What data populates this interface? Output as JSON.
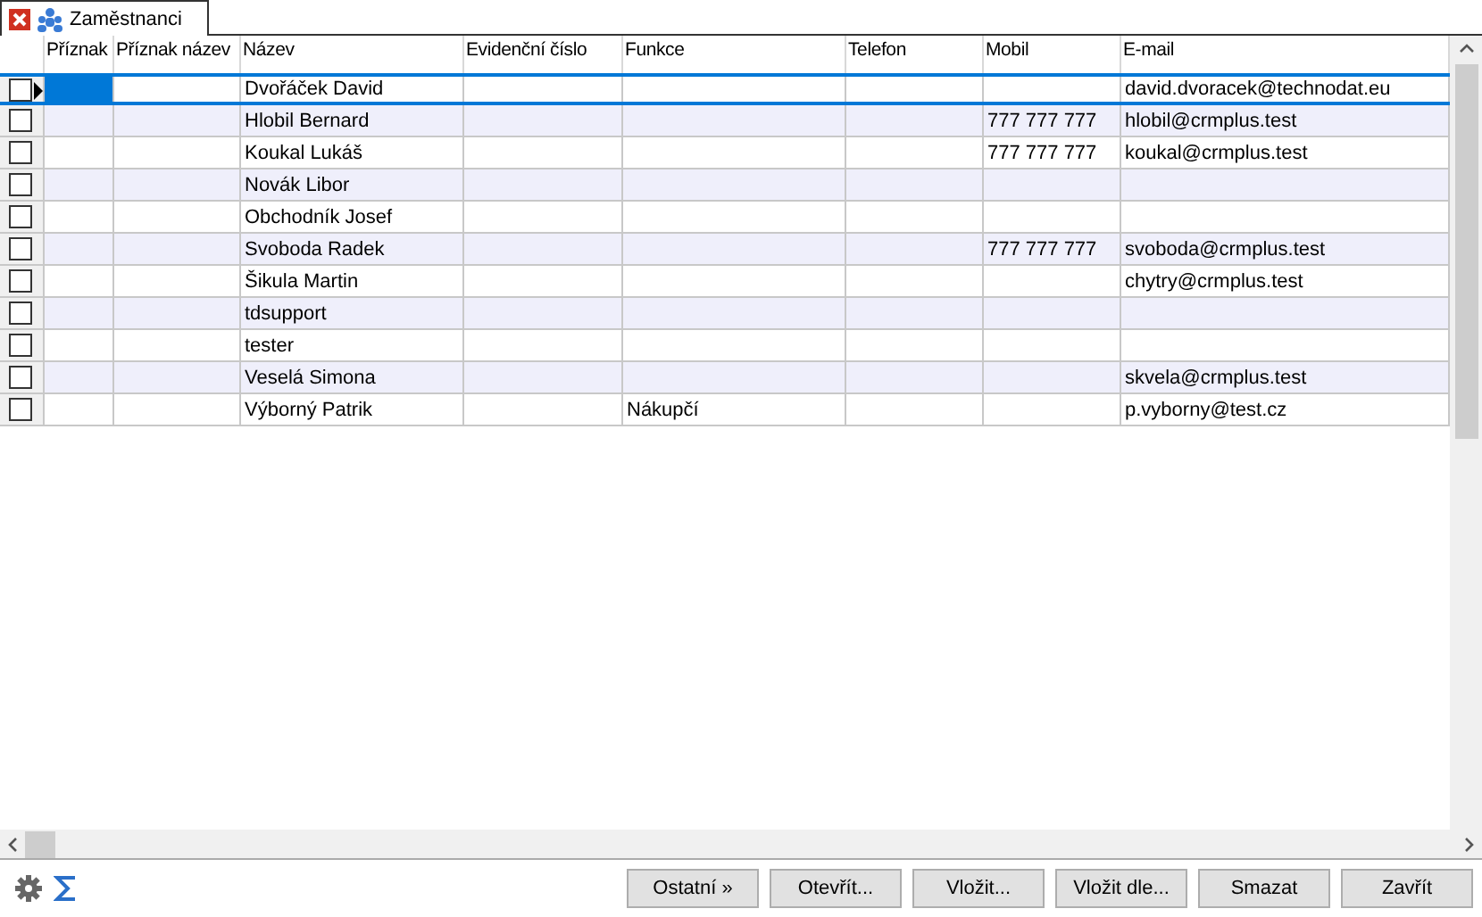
{
  "tab": {
    "title": "Zaměstnanci",
    "selected": true
  },
  "table": {
    "columns": [
      "Příznak",
      "Příznak název",
      "Název",
      "Evidenční číslo",
      "Funkce",
      "Telefon",
      "Mobil",
      "E-mail"
    ],
    "rows": [
      {
        "selected": true,
        "checked": false,
        "cells": [
          "",
          "",
          "Dvořáček David",
          "",
          "",
          "",
          "",
          "david.dvoracek@technodat.eu"
        ]
      },
      {
        "selected": false,
        "checked": false,
        "cells": [
          "",
          "",
          "Hlobil Bernard",
          "",
          "",
          "",
          "777 777 777",
          "hlobil@crmplus.test"
        ]
      },
      {
        "selected": false,
        "checked": false,
        "cells": [
          "",
          "",
          "Koukal Lukáš",
          "",
          "",
          "",
          "777 777 777",
          "koukal@crmplus.test"
        ]
      },
      {
        "selected": false,
        "checked": false,
        "cells": [
          "",
          "",
          "Novák Libor",
          "",
          "",
          "",
          "",
          ""
        ]
      },
      {
        "selected": false,
        "checked": false,
        "cells": [
          "",
          "",
          "Obchodník Josef",
          "",
          "",
          "",
          "",
          ""
        ]
      },
      {
        "selected": false,
        "checked": false,
        "cells": [
          "",
          "",
          "Svoboda Radek",
          "",
          "",
          "",
          "777 777 777",
          "svoboda@crmplus.test"
        ]
      },
      {
        "selected": false,
        "checked": false,
        "cells": [
          "",
          "",
          "Šikula Martin",
          "",
          "",
          "",
          "",
          "chytry@crmplus.test"
        ]
      },
      {
        "selected": false,
        "checked": false,
        "cells": [
          "",
          "",
          "tdsupport",
          "",
          "",
          "",
          "",
          ""
        ]
      },
      {
        "selected": false,
        "checked": false,
        "cells": [
          "",
          "",
          "tester",
          "",
          "",
          "",
          "",
          ""
        ]
      },
      {
        "selected": false,
        "checked": false,
        "cells": [
          "",
          "",
          "Veselá Simona",
          "",
          "",
          "",
          "",
          "skvela@crmplus.test"
        ]
      },
      {
        "selected": false,
        "checked": false,
        "cells": [
          "",
          "",
          "Výborný Patrik",
          "",
          "Nákupčí",
          "",
          "",
          "p.vyborny@test.cz"
        ]
      }
    ]
  },
  "buttons": [
    "Ostatní »",
    "Otevřít...",
    "Vložit...",
    "Vložit dle...",
    "Smazat",
    "Zavřít"
  ]
}
